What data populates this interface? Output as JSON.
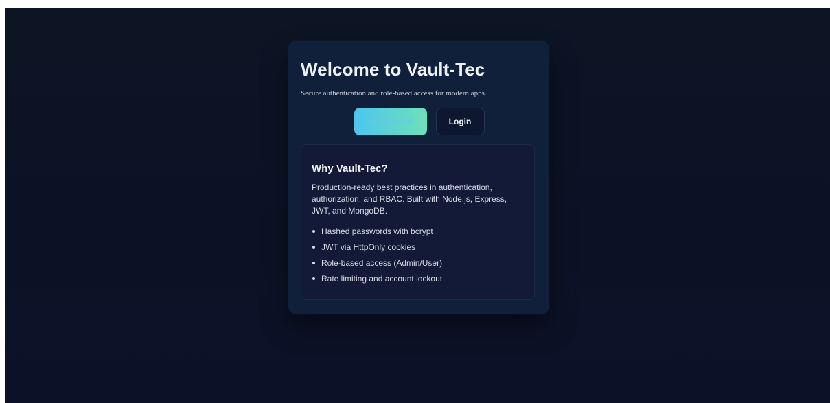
{
  "hero": {
    "title": "Welcome to Vault-Tec",
    "subtitle": "Secure authentication and role-based access for modern apps."
  },
  "actions": {
    "get_started_label": "Get Started",
    "login_label": "Login"
  },
  "info": {
    "title": "Why Vault-Tec?",
    "description": "Production-ready best practices in authentication, authorization, and RBAC. Built with Node.js, Express, JWT, and MongoDB.",
    "features": [
      "Hashed passwords with bcrypt",
      "JWT via HttpOnly cookies",
      "Role-based access (Admin/User)",
      "Rate limiting and account lockout"
    ]
  },
  "colors": {
    "background": "#0c1226",
    "card": "#10203a",
    "accent_start": "#4cc6ee",
    "accent_end": "#6fe0b8"
  }
}
